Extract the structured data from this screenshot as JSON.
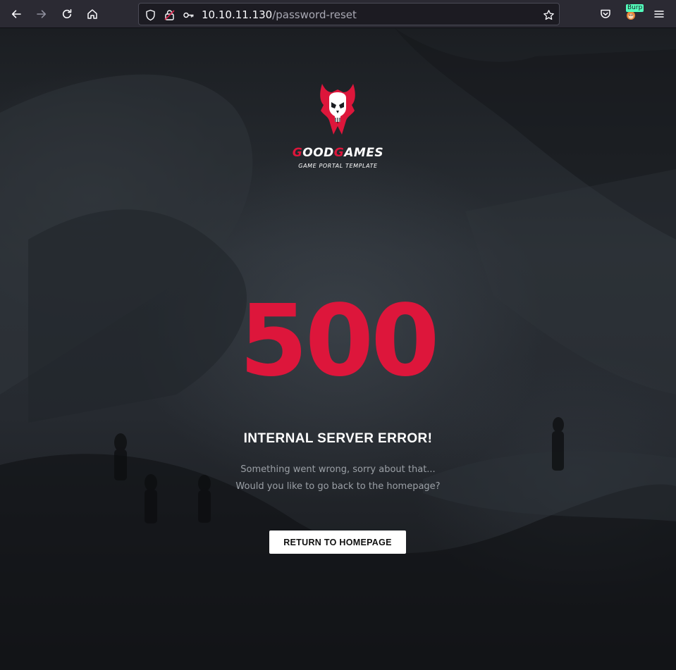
{
  "browser": {
    "url_host": "10.10.11.130",
    "url_path": "/password-reset",
    "extension_badge": "Burp",
    "icons": {
      "back": "arrow-left-icon",
      "forward": "arrow-right-icon",
      "reload": "reload-icon",
      "home": "home-icon",
      "tracking": "shield-icon",
      "permissions": "permissions-icon",
      "key": "key-icon",
      "bookmark": "star-icon",
      "pocket": "pocket-icon",
      "extension": "foxyproxy-icon",
      "menu": "hamburger-menu-icon"
    }
  },
  "logo": {
    "name_part1_initial": "G",
    "name_part1_rest": "OOD",
    "name_part2_initial": "G",
    "name_part2_rest": "AMES",
    "tagline": "GAME PORTAL TEMPLATE",
    "icon": "skull-logo-icon"
  },
  "error": {
    "code": "500",
    "title": "INTERNAL SERVER ERROR!",
    "line1": "Something went wrong, sorry about that...",
    "line2": "Would you like to go back to the homepage?"
  },
  "action": {
    "button_label": "RETURN TO HOMEPAGE"
  },
  "colors": {
    "accent": "#dd163b",
    "toolbar_bg": "#2b2a33",
    "urlbar_bg": "#1c1b22",
    "button_bg": "#ffffff"
  }
}
